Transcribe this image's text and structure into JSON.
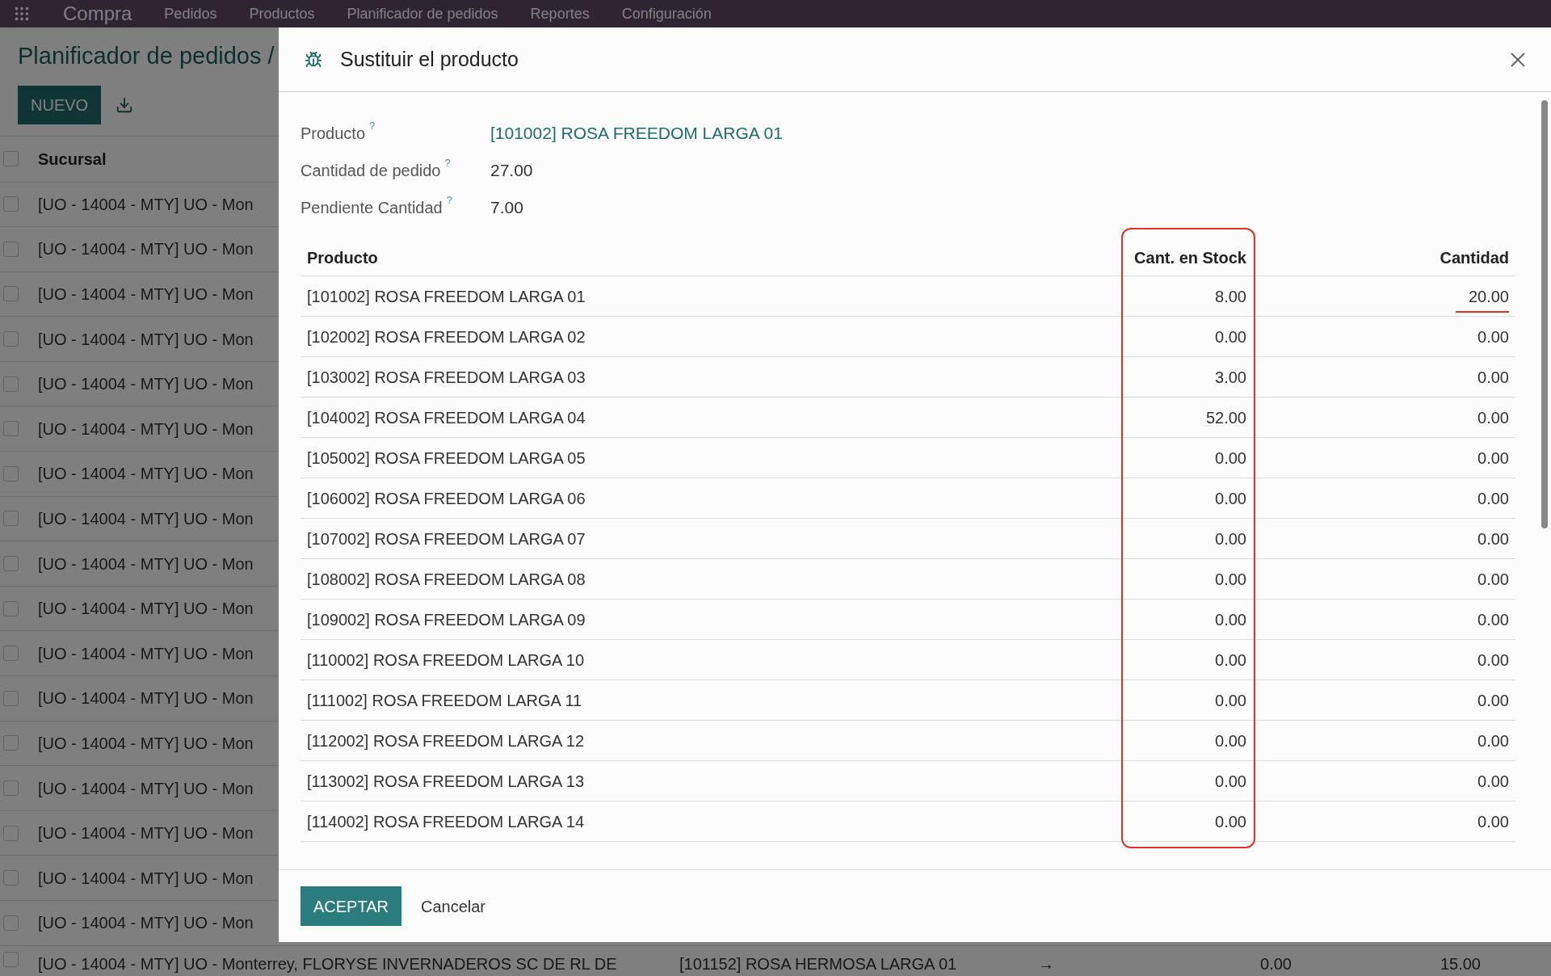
{
  "nav": {
    "app": "Compra",
    "menus": [
      "Pedidos",
      "Productos",
      "Planificador de pedidos",
      "Reportes",
      "Configuración"
    ]
  },
  "page": {
    "breadcrumb": "Planificador de pedidos /",
    "new_button": "NUEVO"
  },
  "list": {
    "header": {
      "label": "Sucursal",
      "checked": false
    },
    "rows": [
      {
        "checked": false,
        "cells": [
          "[UO - 14004 - MTY] UO - Mon"
        ]
      },
      {
        "checked": false,
        "cells": [
          "[UO - 14004 - MTY] UO - Mon"
        ]
      },
      {
        "checked": false,
        "cells": [
          "[UO - 14004 - MTY] UO - Mon"
        ]
      },
      {
        "checked": false,
        "cells": [
          "[UO - 14004 - MTY] UO - Mon"
        ]
      },
      {
        "checked": false,
        "cells": [
          "[UO - 14004 - MTY] UO - Mon"
        ]
      },
      {
        "checked": false,
        "cells": [
          "[UO - 14004 - MTY] UO - Mon"
        ]
      },
      {
        "checked": false,
        "cells": [
          "[UO - 14004 - MTY] UO - Mon"
        ]
      },
      {
        "checked": false,
        "cells": [
          "[UO - 14004 - MTY] UO - Mon"
        ]
      },
      {
        "checked": false,
        "cells": [
          "[UO - 14004 - MTY] UO - Mon"
        ]
      },
      {
        "checked": false,
        "cells": [
          "[UO - 14004 - MTY] UO - Mon"
        ]
      },
      {
        "checked": false,
        "cells": [
          "[UO - 14004 - MTY] UO - Mon"
        ]
      },
      {
        "checked": false,
        "cells": [
          "[UO - 14004 - MTY] UO - Mon"
        ]
      },
      {
        "checked": false,
        "cells": [
          "[UO - 14004 - MTY] UO - Mon"
        ]
      },
      {
        "checked": false,
        "cells": [
          "[UO - 14004 - MTY] UO - Mon"
        ]
      },
      {
        "checked": false,
        "cells": [
          "[UO - 14004 - MTY] UO - Mon"
        ]
      },
      {
        "checked": false,
        "cells": [
          "[UO - 14004 - MTY] UO - Mon"
        ]
      },
      {
        "checked": false,
        "cells": [
          "[UO - 14004 - MTY] UO - Mon"
        ]
      },
      {
        "checked": false,
        "cells": [
          "[UO - 14004 - MTY] UO - Monterrey, FLORYSE INVERNADEROS SC DE RL DE",
          "[101152] ROSA HERMOSA LARGA 01",
          "→",
          "0.00",
          "15.00"
        ]
      }
    ]
  },
  "dialog": {
    "title": "Sustituir el producto",
    "fields": [
      {
        "label": "Producto",
        "help": "?",
        "value": "[101002] ROSA FREEDOM LARGA 01",
        "kind": "link"
      },
      {
        "label": "Cantidad de pedido",
        "help": "?",
        "value": "27.00",
        "kind": "text"
      },
      {
        "label": "Pendiente Cantidad",
        "help": "?",
        "value": "7.00",
        "kind": "text"
      }
    ],
    "table": {
      "columns": [
        {
          "label": "Producto",
          "highlighted": false
        },
        {
          "label": "Cant. en Stock",
          "highlighted": true
        },
        {
          "label": "Cantidad",
          "highlighted": false
        }
      ],
      "rows": [
        {
          "product": "[101002] ROSA FREEDOM LARGA 01",
          "stock": "8.00",
          "quantity": "20.00",
          "editing": true
        },
        {
          "product": "[102002] ROSA FREEDOM LARGA 02",
          "stock": "0.00",
          "quantity": "0.00",
          "editing": false
        },
        {
          "product": "[103002] ROSA FREEDOM LARGA 03",
          "stock": "3.00",
          "quantity": "0.00",
          "editing": false
        },
        {
          "product": "[104002] ROSA FREEDOM LARGA 04",
          "stock": "52.00",
          "quantity": "0.00",
          "editing": false
        },
        {
          "product": "[105002] ROSA FREEDOM LARGA 05",
          "stock": "0.00",
          "quantity": "0.00",
          "editing": false
        },
        {
          "product": "[106002] ROSA FREEDOM LARGA 06",
          "stock": "0.00",
          "quantity": "0.00",
          "editing": false
        },
        {
          "product": "[107002] ROSA FREEDOM LARGA 07",
          "stock": "0.00",
          "quantity": "0.00",
          "editing": false
        },
        {
          "product": "[108002] ROSA FREEDOM LARGA 08",
          "stock": "0.00",
          "quantity": "0.00",
          "editing": false
        },
        {
          "product": "[109002] ROSA FREEDOM LARGA 09",
          "stock": "0.00",
          "quantity": "0.00",
          "editing": false
        },
        {
          "product": "[110002] ROSA FREEDOM LARGA 10",
          "stock": "0.00",
          "quantity": "0.00",
          "editing": false
        },
        {
          "product": "[111002] ROSA FREEDOM LARGA 11",
          "stock": "0.00",
          "quantity": "0.00",
          "editing": false
        },
        {
          "product": "[112002] ROSA FREEDOM LARGA 12",
          "stock": "0.00",
          "quantity": "0.00",
          "editing": false
        },
        {
          "product": "[113002] ROSA FREEDOM LARGA 13",
          "stock": "0.00",
          "quantity": "0.00",
          "editing": false
        },
        {
          "product": "[114002] ROSA FREEDOM LARGA 14",
          "stock": "0.00",
          "quantity": "0.00",
          "editing": false
        }
      ]
    },
    "buttons": [
      {
        "label": "ACEPTAR",
        "kind": "primary"
      },
      {
        "label": "Cancelar",
        "kind": "secondary"
      }
    ]
  }
}
